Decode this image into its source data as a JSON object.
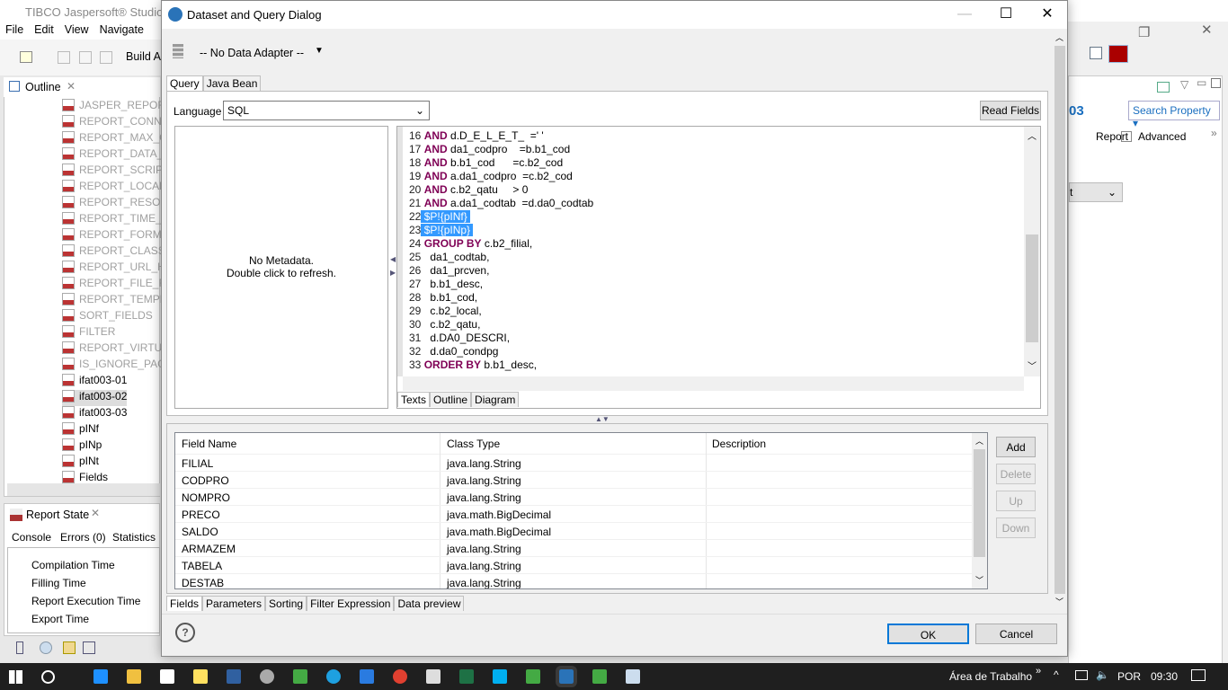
{
  "app": {
    "title": "TIBCO Jaspersoft® Studio",
    "menu": [
      "File",
      "Edit",
      "View",
      "Navigate",
      "P"
    ],
    "build_label": "Build A"
  },
  "outline": {
    "tab": "Outline",
    "items": [
      {
        "label": "JASPER_REPORT",
        "active": false
      },
      {
        "label": "REPORT_CONNE",
        "active": false
      },
      {
        "label": "REPORT_MAX_CO",
        "active": false
      },
      {
        "label": "REPORT_DATA_SO",
        "active": false
      },
      {
        "label": "REPORT_SCRIPTL",
        "active": false
      },
      {
        "label": "REPORT_LOCALE",
        "active": false
      },
      {
        "label": "REPORT_RESOUR",
        "active": false
      },
      {
        "label": "REPORT_TIME_ZO",
        "active": false
      },
      {
        "label": "REPORT_FORMAT",
        "active": false
      },
      {
        "label": "REPORT_CLASS_L",
        "active": false
      },
      {
        "label": "REPORT_URL_HA",
        "active": false
      },
      {
        "label": "REPORT_FILE_RES",
        "active": false
      },
      {
        "label": "REPORT_TEMPLA",
        "active": false
      },
      {
        "label": "SORT_FIELDS",
        "active": false
      },
      {
        "label": "FILTER",
        "active": false
      },
      {
        "label": "REPORT_VIRTUAL",
        "active": false
      },
      {
        "label": "IS_IGNORE_PAGIN",
        "active": false
      },
      {
        "label": "ifat003-01",
        "active": true
      },
      {
        "label": "ifat003-02",
        "active": true
      },
      {
        "label": "ifat003-03",
        "active": true
      },
      {
        "label": "pINf",
        "active": true
      },
      {
        "label": "pINp",
        "active": true
      },
      {
        "label": "pINt",
        "active": true
      },
      {
        "label": "Fields",
        "active": true
      }
    ]
  },
  "report_state": {
    "tab": "Report State",
    "subtabs": [
      "Console",
      "Errors (0)",
      "Statistics"
    ],
    "items": [
      "Compilation Time",
      "Filling Time",
      "Report Execution Time",
      "Export Time"
    ]
  },
  "right": {
    "title_fragment": "03",
    "search": "Search Property",
    "tab_report": "Report",
    "tab_advanced": "Advanced",
    "combo_fragment": "t"
  },
  "dialog": {
    "title": "Dataset and Query Dialog",
    "adapter": "-- No Data Adapter --",
    "tabs": [
      "Query",
      "Java Bean"
    ],
    "language_label": "Language",
    "language": "SQL",
    "read_fields": "Read Fields",
    "metadata_line1": "No Metadata.",
    "metadata_line2": "Double click to refresh.",
    "code": [
      {
        "n": "16",
        "kw": "AND",
        "rest": " d.D_E_L_E_T_  =' '"
      },
      {
        "n": "17",
        "kw": "AND",
        "rest": " da1_codpro    =b.b1_cod"
      },
      {
        "n": "18",
        "kw": "AND",
        "rest": " b.b1_cod      =c.b2_cod"
      },
      {
        "n": "19",
        "kw": "AND",
        "rest": " a.da1_codpro  =c.b2_cod"
      },
      {
        "n": "20",
        "kw": "AND",
        "rest": " c.b2_qatu     > 0"
      },
      {
        "n": "21",
        "kw": "AND",
        "rest": " a.da1_codtab  =d.da0_codtab"
      },
      {
        "n": "22",
        "hl": " $P!{pINf} "
      },
      {
        "n": "23",
        "hl": " $P!{pINp} "
      },
      {
        "n": "24",
        "kw": "GROUP BY",
        "rest": " c.b2_filial,"
      },
      {
        "n": "25",
        "rest": "  da1_codtab,"
      },
      {
        "n": "26",
        "rest": "  da1_prcven,"
      },
      {
        "n": "27",
        "rest": "  b.b1_desc,"
      },
      {
        "n": "28",
        "rest": "  b.b1_cod,"
      },
      {
        "n": "29",
        "rest": "  c.b2_local,"
      },
      {
        "n": "30",
        "rest": "  c.b2_qatu,"
      },
      {
        "n": "31",
        "rest": "  d.DA0_DESCRI,"
      },
      {
        "n": "32",
        "rest": "  d.da0_condpg"
      },
      {
        "n": "33",
        "kw": "ORDER BY",
        "rest": " b.b1_desc,"
      }
    ],
    "editor_tabs": [
      "Texts",
      "Outline",
      "Diagram"
    ],
    "fields_columns": [
      "Field Name",
      "Class Type",
      "Description"
    ],
    "fields": [
      [
        "FILIAL",
        "java.lang.String",
        ""
      ],
      [
        "CODPRO",
        "java.lang.String",
        ""
      ],
      [
        "NOMPRO",
        "java.lang.String",
        ""
      ],
      [
        "PRECO",
        "java.math.BigDecimal",
        ""
      ],
      [
        "SALDO",
        "java.math.BigDecimal",
        ""
      ],
      [
        "ARMAZEM",
        "java.lang.String",
        ""
      ],
      [
        "TABELA",
        "java.lang.String",
        ""
      ],
      [
        "DESTAB",
        "java.lang.String",
        ""
      ]
    ],
    "side_buttons": [
      "Add",
      "Delete",
      "Up",
      "Down"
    ],
    "bottom_tabs": [
      "Fields",
      "Parameters",
      "Sorting",
      "Filter Expression",
      "Data preview"
    ],
    "ok": "OK",
    "cancel": "Cancel"
  },
  "taskbar": {
    "desktop": "Área de Trabalho",
    "lang": "POR",
    "time": "09:30"
  }
}
